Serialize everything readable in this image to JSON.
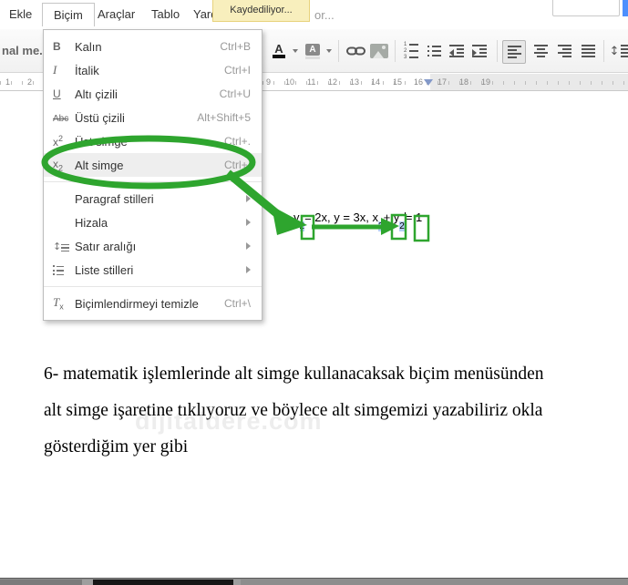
{
  "colors": {
    "annotation_green": "#2ea52e",
    "selection_blue": "#b7d0f8",
    "toast_yellow": "#f8efbd",
    "share_blue": "#4d8ffd"
  },
  "menu_bar": {
    "items": [
      "Ekle",
      "Biçim",
      "Araçlar",
      "Tablo",
      "Yard"
    ],
    "active_item": "Biçim",
    "saving_toast": "Kaydediliyor...",
    "overflow_text": "or..."
  },
  "toolbar": {
    "style_selector": "nal me...",
    "glyphs": {
      "text_color": "A",
      "highlight": "A"
    },
    "numbered_list_digits": [
      "1",
      "2",
      "3"
    ],
    "icons": [
      "text-color",
      "highlight-color",
      "insert-link",
      "insert-image",
      "numbered-list",
      "bulleted-list",
      "decrease-indent",
      "increase-indent",
      "align-left",
      "align-center",
      "align-right",
      "justify",
      "line-spacing"
    ],
    "active_icon": "align-left"
  },
  "ruler": {
    "left_numbers": [
      "1",
      "2"
    ],
    "right_numbers": [
      "9",
      "10",
      "11",
      "12",
      "13",
      "14",
      "15",
      "16",
      "17",
      "18",
      "19"
    ]
  },
  "format_menu": {
    "items": [
      {
        "label": "Kalın",
        "shortcut": "Ctrl+B",
        "icon": "bold-icon"
      },
      {
        "label": "İtalik",
        "shortcut": "Ctrl+I",
        "icon": "italic-icon"
      },
      {
        "label": "Altı çizili",
        "shortcut": "Ctrl+U",
        "icon": "underline-icon"
      },
      {
        "label": "Üstü çizili",
        "shortcut": "Alt+Shift+5",
        "icon": "strikethrough-icon"
      },
      {
        "label": "Üst simge",
        "shortcut": "Ctrl+.",
        "icon": "superscript-icon"
      },
      {
        "label": "Alt simge",
        "shortcut": "Ctrl+,",
        "icon": "subscript-icon",
        "highlighted": true
      },
      {
        "label": "Paragraf stilleri",
        "submenu": true
      },
      {
        "label": "Hizala",
        "submenu": true
      },
      {
        "label": "Satır aralığı",
        "submenu": true,
        "icon": "line-spacing-icon"
      },
      {
        "label": "Liste stilleri",
        "submenu": true,
        "icon": "list-styles-icon"
      },
      {
        "label": "Biçimlendirmeyi temizle",
        "shortcut": "Ctrl+\\",
        "icon": "clear-formatting-icon"
      }
    ]
  },
  "menu_icon_glyphs": {
    "bold": "B",
    "italic": "I",
    "underline": "U",
    "strikethrough": "Abc",
    "sup_base": "x",
    "sup_exp": "2",
    "sub_base": "x",
    "sub_sub": "2",
    "clear_base": "T",
    "clear_sub": "x",
    "updown_arrow": "↕"
  },
  "document": {
    "formula": {
      "p1": "y",
      "s1": "2",
      "p2": "= 2x, y = 3x, x",
      "s2": "2",
      "p3": "+ y",
      "s3": "2",
      "p4": "= 1"
    },
    "paragraph_lines": [
      "6- matematik işlemlerinde alt simge kullanacaksak biçim menüsünden",
      "alt simge işaretine tıklıyoruz ve böylece alt simgemizi yazabiliriz okla",
      "gösterdiğim yer gibi"
    ],
    "watermark": "dijitaldere.com"
  }
}
